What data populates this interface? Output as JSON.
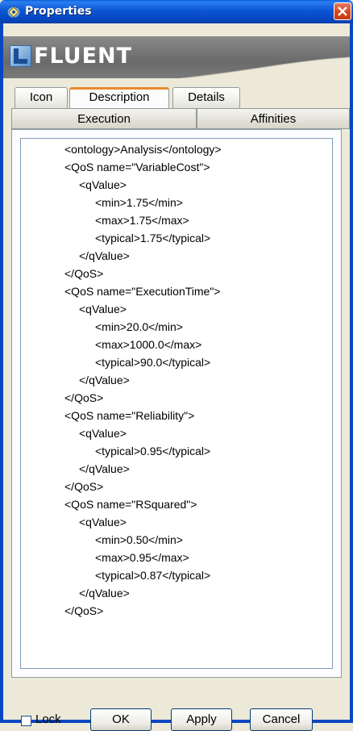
{
  "window": {
    "title": "Properties"
  },
  "banner": {
    "logo_text": "FLUENT"
  },
  "tabs": {
    "row1": [
      {
        "label": "Icon"
      },
      {
        "label": "Description",
        "active": true
      },
      {
        "label": "Details"
      }
    ],
    "row2": [
      {
        "label": "Execution"
      },
      {
        "label": "Affinities"
      }
    ]
  },
  "description_lines": [
    "<ontology>Analysis</ontology>",
    "<QoS name=\"VariableCost\">",
    "<qValue>",
    "<min>1.75</min>",
    "<max>1.75</max>",
    "<typical>1.75</typical>",
    "</qValue>",
    "</QoS>",
    "<QoS name=\"ExecutionTime\">",
    "<qValue>",
    "<min>20.0</min>",
    "<max>1000.0</max>",
    "<typical>90.0</typical>",
    "</qValue>",
    "</QoS>",
    "<QoS name=\"Reliability\">",
    "<qValue>",
    "<typical>0.95</typical>",
    "</qValue>",
    "</QoS>",
    "<QoS name=\"RSquared\">",
    "<qValue>",
    "<min>0.50</min>",
    "<max>0.95</max>",
    "<typical>0.87</typical>",
    "</qValue>",
    "</QoS>"
  ],
  "footer": {
    "lock_label": "Lock",
    "ok_label": "OK",
    "apply_label": "Apply",
    "cancel_label": "Cancel"
  },
  "colors": {
    "titlebar": "#0b56d4",
    "active_tab_accent": "#e68b2c",
    "close_button": "#d64416"
  }
}
